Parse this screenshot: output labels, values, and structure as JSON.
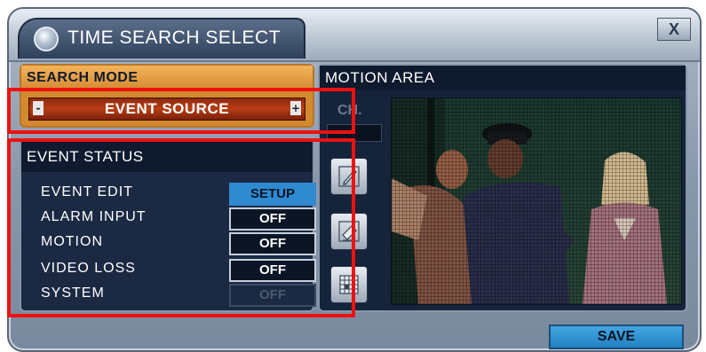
{
  "window": {
    "title": "TIME SEARCH SELECT",
    "close_label": "X"
  },
  "search_mode": {
    "header": "SEARCH MODE",
    "value": "EVENT SOURCE",
    "left_arrow": "-",
    "right_arrow": "+"
  },
  "event_status": {
    "header": "EVENT STATUS",
    "rows": [
      {
        "label": "EVENT EDIT",
        "value": "SETUP"
      },
      {
        "label": "ALARM INPUT",
        "value": "OFF"
      },
      {
        "label": "MOTION",
        "value": "OFF"
      },
      {
        "label": "VIDEO LOSS",
        "value": "OFF"
      },
      {
        "label": "SYSTEM",
        "value": "OFF"
      }
    ]
  },
  "motion_area": {
    "header": "MOTION AREA",
    "channel_label": "CH.",
    "tools": [
      "pencil-icon",
      "eraser-icon",
      "grid-icon"
    ]
  },
  "footer": {
    "save_label": "SAVE"
  },
  "colors": {
    "highlight": "#ee1111",
    "search_mode_header": "#f2b35b",
    "select_value_bg": "#b83d14",
    "setup_button": "#2f8ad0",
    "save_button": "#2f8ad0"
  }
}
